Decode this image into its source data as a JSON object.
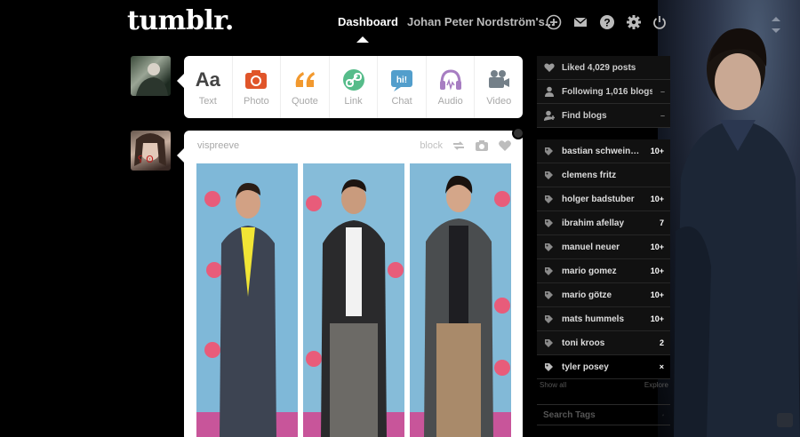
{
  "header": {
    "logo": "tumblr.",
    "nav_dashboard": "Dashboard",
    "nav_blog": "Johan Peter Nordström's...",
    "icons": [
      "plus-icon",
      "mail-icon",
      "help-icon",
      "gear-icon",
      "power-icon"
    ]
  },
  "post_types": [
    {
      "label": "Text",
      "icon": "text-icon",
      "glyph": "Aa",
      "color": "#444444"
    },
    {
      "label": "Photo",
      "icon": "camera-icon",
      "color": "#e0552a"
    },
    {
      "label": "Quote",
      "icon": "quote-icon",
      "color": "#f2992e"
    },
    {
      "label": "Link",
      "icon": "link-icon",
      "color": "#56bc8a"
    },
    {
      "label": "Chat",
      "icon": "chat-icon",
      "glyph": "hi!",
      "color": "#529ecc"
    },
    {
      "label": "Audio",
      "icon": "headphones-icon",
      "color": "#a77dc2"
    },
    {
      "label": "Video",
      "icon": "video-camera-icon",
      "color": "#748089"
    }
  ],
  "post": {
    "author": "vispreeve",
    "block_label": "block",
    "action_icons": [
      "reblog-icon",
      "photo-icon",
      "heart-icon"
    ]
  },
  "sidebar": {
    "liked": "Liked 4,029 posts",
    "following": "Following 1,016 blogs",
    "find_blogs": "Find blogs",
    "tags": [
      {
        "name": "bastian schweinste...",
        "count": "10+"
      },
      {
        "name": "clemens fritz",
        "count": ""
      },
      {
        "name": "holger badstuber",
        "count": "10+"
      },
      {
        "name": "ibrahim afellay",
        "count": "7"
      },
      {
        "name": "manuel neuer",
        "count": "10+"
      },
      {
        "name": "mario gomez",
        "count": "10+"
      },
      {
        "name": "mario götze",
        "count": "10+"
      },
      {
        "name": "mats hummels",
        "count": "10+"
      },
      {
        "name": "toni kroos",
        "count": "2"
      },
      {
        "name": "tyler posey",
        "count": "×"
      }
    ],
    "show_all": "Show all",
    "explore": "Explore",
    "search_placeholder": "Search Tags"
  },
  "colors": {
    "accent_blue": "#529ecc",
    "background": "#000000"
  }
}
